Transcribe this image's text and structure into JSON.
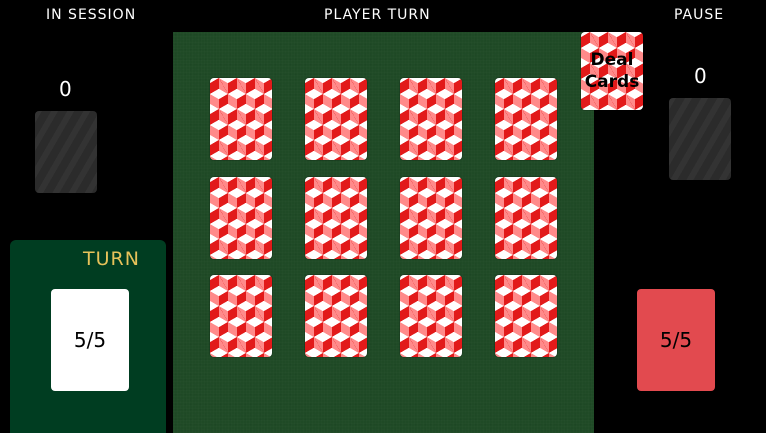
{
  "hud": {
    "session": "IN SESSION",
    "turn_title": "PLAYER TURN",
    "pause": "PAUSE"
  },
  "deal_button": {
    "line1": "Deal",
    "line2": "Cards"
  },
  "players": {
    "left": {
      "score": "0",
      "count": "5/5",
      "card_color": "#ffffff"
    },
    "right": {
      "score": "0",
      "count": "5/5",
      "card_color": "#e24a4f"
    }
  },
  "turn_indicator": {
    "label": "TURN",
    "color": "#e7c25a",
    "panel_color": "#003d21"
  },
  "table": {
    "felt_color": "#1f4a26",
    "card_back_color": "#e21a1a",
    "grid": [
      [
        "card-back",
        "card-back",
        "card-back",
        "card-back"
      ],
      [
        "card-back",
        "card-back",
        "card-back",
        "card-back"
      ],
      [
        "card-back",
        "card-back",
        "card-back",
        "card-back"
      ]
    ]
  }
}
